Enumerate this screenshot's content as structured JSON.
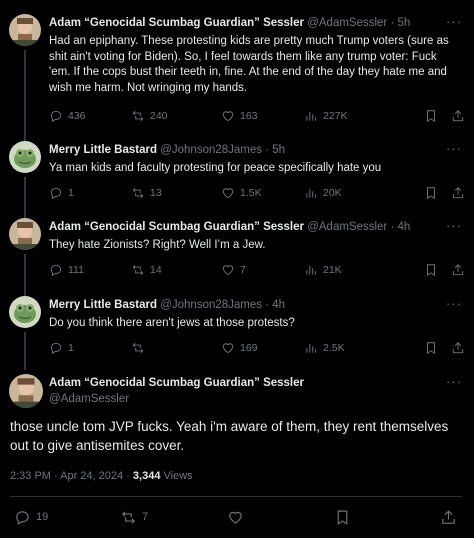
{
  "replies": [
    {
      "name": "Adam “Genocidal Scumbag Guardian” Sessler",
      "handle": "@AdamSessler",
      "time": "5h",
      "text": "Had an epiphany. These protesting kids are pretty much Trump voters (sure as shit ain't voting for Biden). So, I feel towards them like any trump voter: Fuck 'em. If the cops bust their teeth in, fine. At the end of the day they hate me and wish me harm. Not wringing my hands.",
      "replies": "436",
      "reposts": "240",
      "likes": "163",
      "views": "227K"
    },
    {
      "name": "Merry Little Bastard",
      "handle": "@Johnson28James",
      "time": "5h",
      "text": "Ya man kids and faculty protesting for peace specifically hate you",
      "replies": "1",
      "reposts": "13",
      "likes": "1.5K",
      "views": "20K"
    },
    {
      "name": "Adam “Genocidal Scumbag Guardian” Sessler",
      "handle": "@AdamSessler",
      "time": "4h",
      "text": "They hate Zionists? Right?  Well I’m a Jew.",
      "replies": "111",
      "reposts": "14",
      "likes": "7",
      "views": "21K"
    },
    {
      "name": "Merry Little Bastard",
      "handle": "@Johnson28James",
      "time": "4h",
      "text": "Do you think there aren't jews at those protests?",
      "replies": "1",
      "reposts": "",
      "likes": "169",
      "views": "2.5K"
    }
  ],
  "main": {
    "name": "Adam “Genocidal Scumbag Guardian” Sessler",
    "handle": "@AdamSessler",
    "text": "those uncle tom JVP fucks. Yeah i'm aware of them, they rent themselves out to give antisemites cover.",
    "timestamp": "2:33 PM · Apr 24, 2024 · ",
    "views_count": "3,344",
    "views_label": " Views",
    "replies": "19",
    "reposts": "7"
  },
  "ui": {
    "more": "···",
    "dot": " · "
  }
}
